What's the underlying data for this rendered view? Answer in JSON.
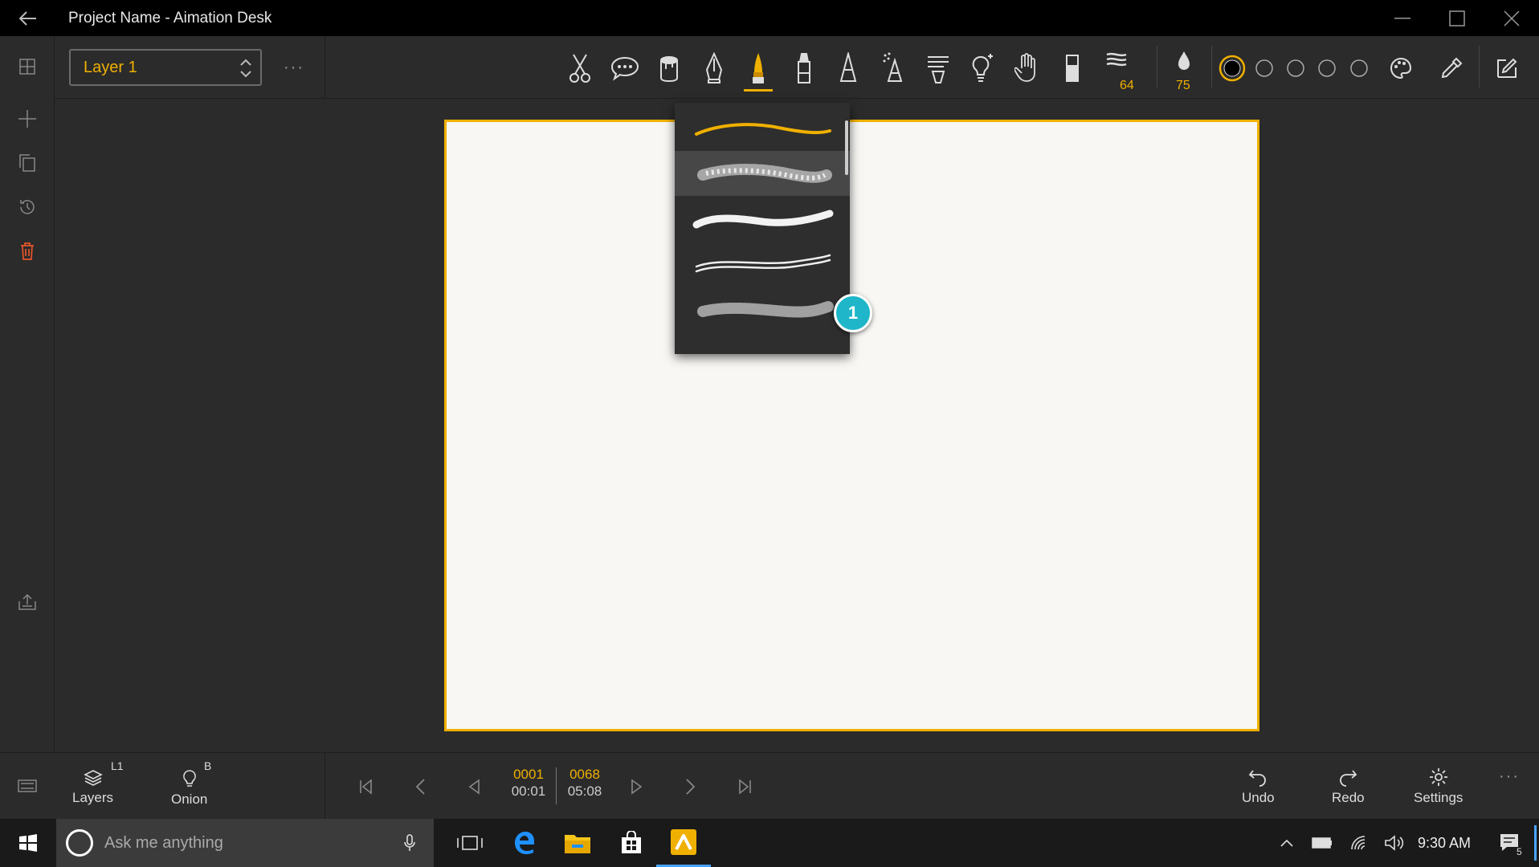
{
  "window": {
    "title": "Project Name - Aimation Desk"
  },
  "toolbar": {
    "layer_select_value": "Layer 1",
    "more_label": "···",
    "stroke_size": "64",
    "opacity": "75"
  },
  "timeline": {
    "current_frame": "0001",
    "current_time": "00:01",
    "total_frames": "0068",
    "total_time": "05:08"
  },
  "bottom": {
    "layers_label": "Layers",
    "layers_sup": "L1",
    "onion_label": "Onion",
    "onion_sup": "B",
    "undo_label": "Undo",
    "redo_label": "Redo",
    "settings_label": "Settings",
    "more_label": "···"
  },
  "brush_popup": {
    "badge": "1"
  },
  "taskbar": {
    "search_placeholder": "Ask me anything",
    "time": "9:30 AM",
    "notification_count": "5"
  },
  "colors": {
    "accent": "#f0b000",
    "badge": "#1fb6c9"
  }
}
